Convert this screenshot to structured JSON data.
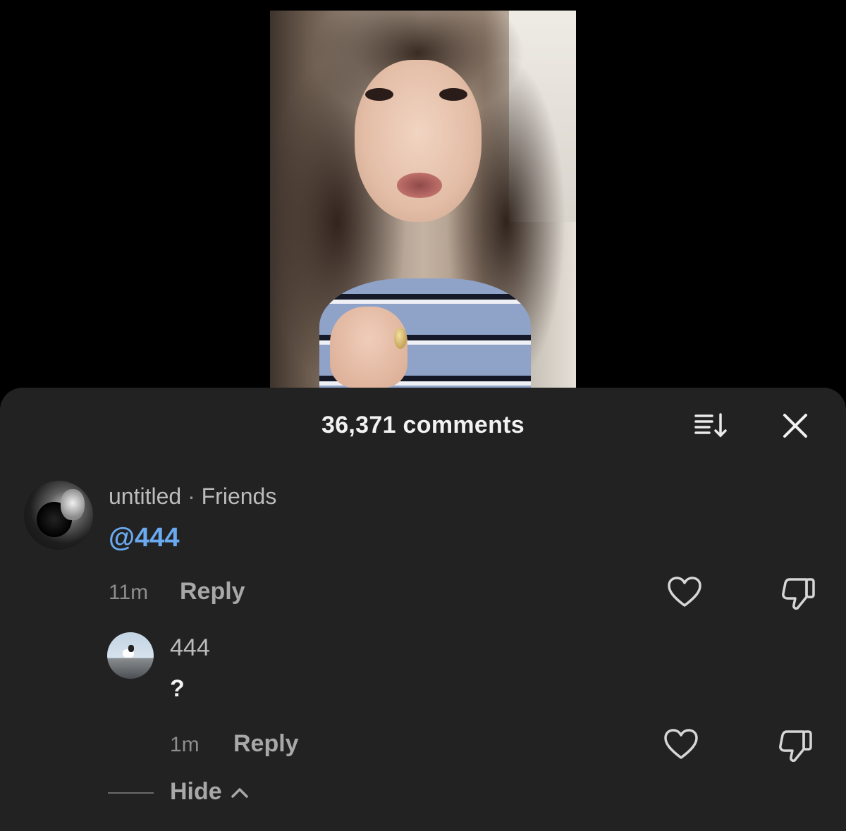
{
  "comments_header": {
    "title": "36,371 comments",
    "sort_icon": "sort-icon",
    "close_icon": "close-icon"
  },
  "comments": [
    {
      "username": "untitled",
      "separator": "·",
      "relation": "Friends",
      "text": "@444",
      "time": "11m",
      "reply_label": "Reply",
      "avatar_icon": "user-avatar"
    }
  ],
  "replies": [
    {
      "username": "444",
      "text": "?",
      "time": "1m",
      "reply_label": "Reply",
      "avatar_icon": "user-avatar"
    }
  ],
  "hide_label": "Hide",
  "colors": {
    "sheet_bg": "#222222",
    "mention": "#6aaaf0",
    "muted_text": "#8d8d8d"
  }
}
